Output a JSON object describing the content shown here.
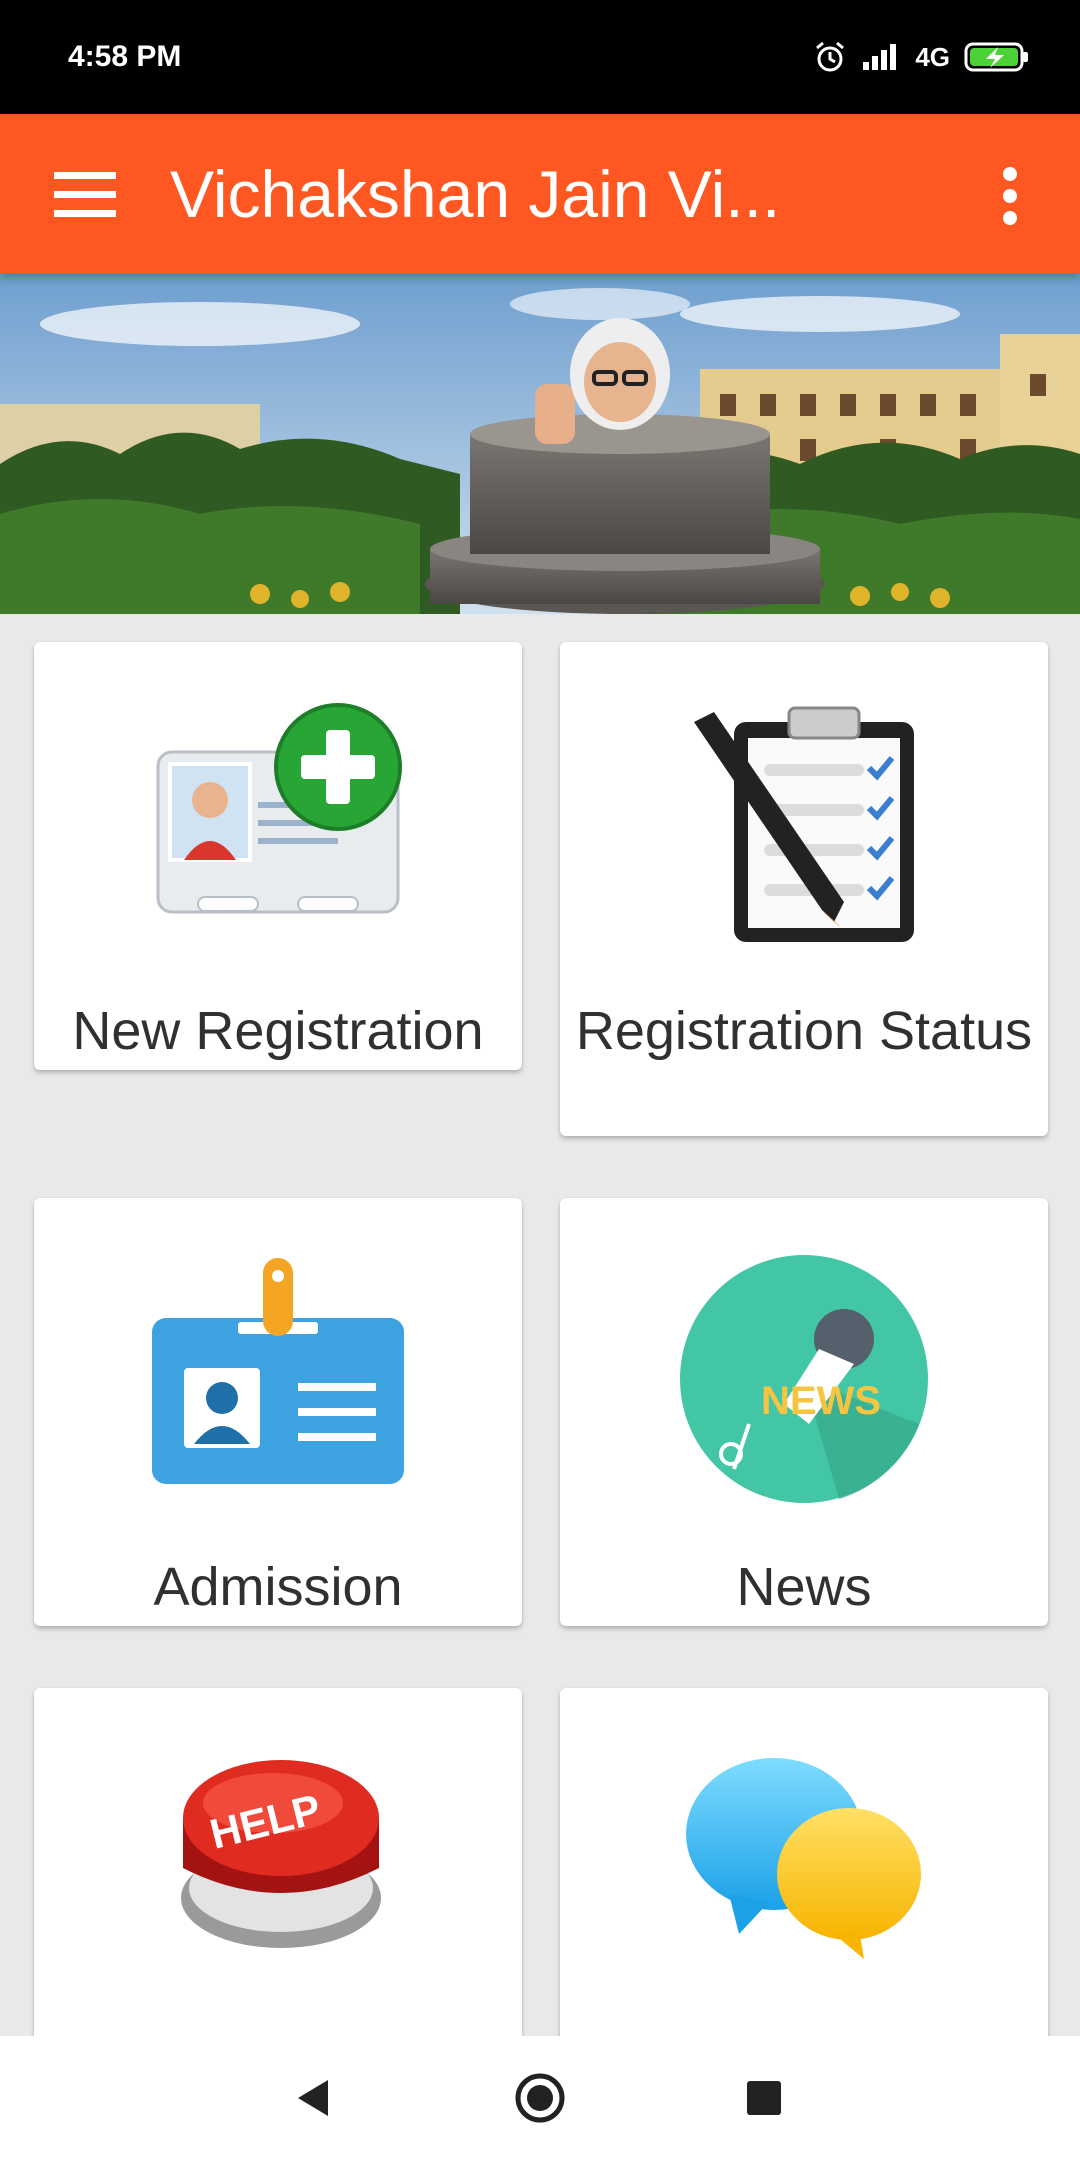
{
  "status_bar": {
    "time": "4:58 PM",
    "network": "4G"
  },
  "app_bar": {
    "title": "Vichakshan Jain Vi...",
    "menu_icon": "hamburger-menu-icon",
    "overflow_icon": "more-vert-icon"
  },
  "colors": {
    "primary": "#ff5722",
    "background": "#e9e9e9",
    "card": "#ffffff",
    "text": "#303030"
  },
  "tiles": [
    {
      "label": "New Registration",
      "icon": "id-card-add-icon"
    },
    {
      "label": "Registration Status",
      "icon": "clipboard-checklist-icon"
    },
    {
      "label": "Admission",
      "icon": "id-badge-icon"
    },
    {
      "label": "News",
      "icon": "news-microphone-icon"
    },
    {
      "label": "",
      "icon": "help-button-icon"
    },
    {
      "label": "",
      "icon": "chat-bubbles-icon"
    }
  ],
  "nav_bar": {
    "back": "back-triangle-icon",
    "home": "home-circle-icon",
    "recents": "recents-square-icon"
  }
}
